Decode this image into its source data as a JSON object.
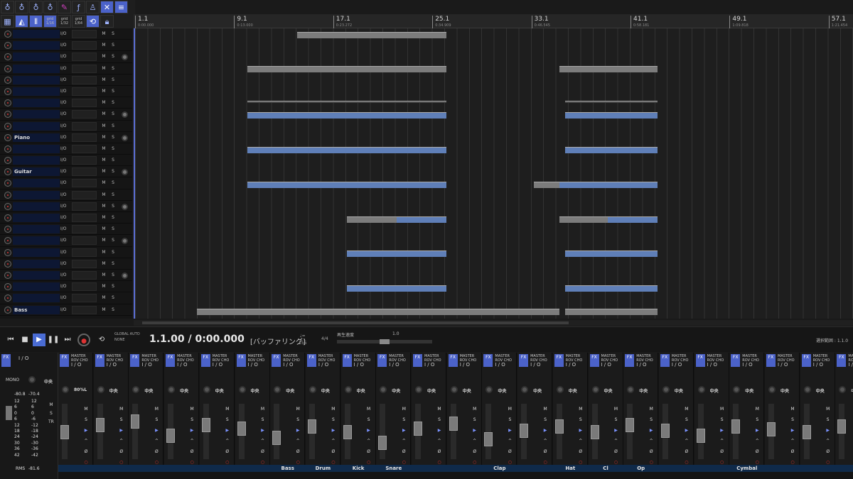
{
  "toolbar": {
    "grid1": "grid",
    "grid1v": "1/16",
    "grid2": "grid",
    "grid2v": "1/32",
    "grid3": "grid",
    "grid3v": "1/64"
  },
  "tracks": [
    {
      "name": ""
    },
    {
      "name": ""
    },
    {
      "name": ""
    },
    {
      "name": ""
    },
    {
      "name": ""
    },
    {
      "name": ""
    },
    {
      "name": ""
    },
    {
      "name": ""
    },
    {
      "name": ""
    },
    {
      "name": "Piano"
    },
    {
      "name": ""
    },
    {
      "name": ""
    },
    {
      "name": "Guitar"
    },
    {
      "name": ""
    },
    {
      "name": ""
    },
    {
      "name": ""
    },
    {
      "name": ""
    },
    {
      "name": ""
    },
    {
      "name": ""
    },
    {
      "name": ""
    },
    {
      "name": ""
    },
    {
      "name": ""
    },
    {
      "name": ""
    },
    {
      "name": ""
    },
    {
      "name": "Bass"
    }
  ],
  "track_io": "I/O",
  "track_m": "M",
  "track_s": "S",
  "ruler": {
    "bars": [
      {
        "label": "1.1",
        "time": "0:00.000"
      },
      {
        "label": "9.1",
        "time": "0:13.000"
      },
      {
        "label": "17.1",
        "time": "0:23.272"
      },
      {
        "label": "25.1",
        "time": "0:34.909"
      },
      {
        "label": "33.1",
        "time": "0:46.545"
      },
      {
        "label": "41.1",
        "time": "0:58.181"
      },
      {
        "label": "49.1",
        "time": "1:09.818"
      },
      {
        "label": "57.1",
        "time": "1:21.454"
      }
    ]
  },
  "transport": {
    "time": "1.1.00 / 0:00.000",
    "buffer": "[バッファリング]",
    "global_auto": "GLOBAL AUTO",
    "global_auto_val": "NONE",
    "tempo": "155",
    "signature": "4/4",
    "speed_label": "再生速度",
    "speed_value": "1.0",
    "range_label": "選択範囲 : 1.1.0"
  },
  "master": {
    "label": "MONO",
    "io": "I / O",
    "pan": "中央",
    "rms": "RMS",
    "rms_val": "-81.6",
    "peak_l": "-80.8",
    "peak_r": "-70.4",
    "scale": [
      "12",
      "6",
      "0",
      "6",
      "12",
      "18",
      "24",
      "30",
      "36",
      "42"
    ],
    "scale_r": [
      "12",
      "6",
      "0",
      "-6",
      "-12",
      "-18",
      "-24",
      "-30",
      "-36",
      "-42"
    ]
  },
  "channel": {
    "master": "MASTER",
    "rev": "ROV",
    "cho": "CHO",
    "io": "I / O",
    "pan": "中央",
    "pan_alt": "80%L",
    "m": "M",
    "s": "S",
    "p": "▶",
    "a": "^",
    "phase": "Ø",
    "rec": "○"
  },
  "channels": [
    {
      "label": ""
    },
    {
      "label": ""
    },
    {
      "label": ""
    },
    {
      "label": ""
    },
    {
      "label": ""
    },
    {
      "label": ""
    },
    {
      "label": "Bass"
    },
    {
      "label": "Drum"
    },
    {
      "label": "Kick"
    },
    {
      "label": "Snare"
    },
    {
      "label": ""
    },
    {
      "label": ""
    },
    {
      "label": "Clap"
    },
    {
      "label": ""
    },
    {
      "label": "Hat"
    },
    {
      "label": "Cl"
    },
    {
      "label": "Op"
    },
    {
      "label": ""
    },
    {
      "label": ""
    },
    {
      "label": "Cymbal"
    },
    {
      "label": ""
    },
    {
      "label": ""
    },
    {
      "label": ""
    }
  ],
  "colors": {
    "accent": "#4b62c9",
    "clip": "#7c7c7c",
    "clip_blue": "#5f7fb8",
    "label_bar": "#0f2a4a",
    "record": "#d93333"
  }
}
